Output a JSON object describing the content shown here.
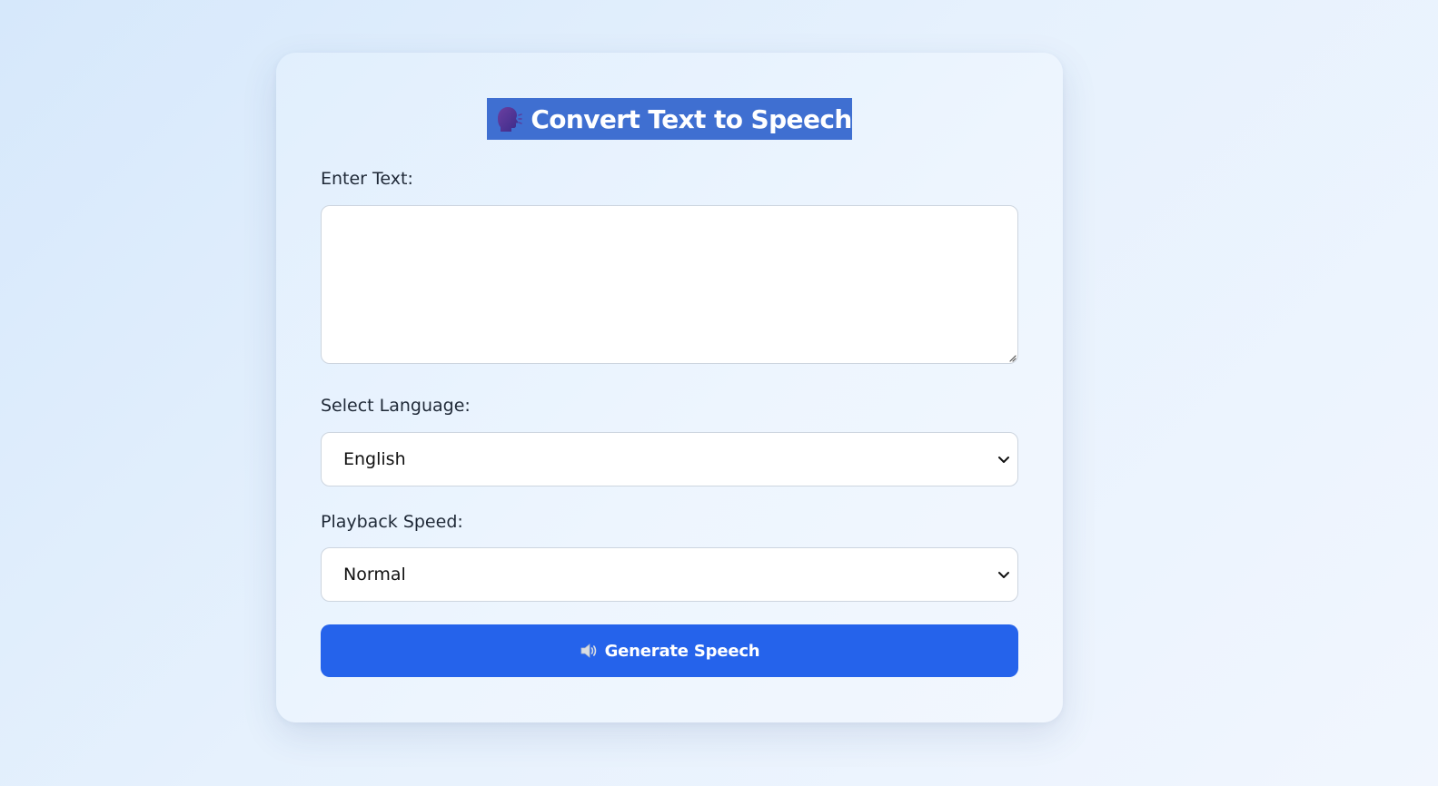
{
  "page": {
    "title_icon": "speaking-head-icon",
    "title": "Convert Text to Speech"
  },
  "form": {
    "text_label": "Enter Text:",
    "text_value": "",
    "language_label": "Select Language:",
    "language_selected": "English",
    "speed_label": "Playback Speed:",
    "speed_selected": "Normal",
    "generate_icon": "speaker-icon",
    "generate_label": "Generate Speech"
  },
  "colors": {
    "accent": "#2563eb",
    "title_highlight": "#3f6fd1",
    "card_background": "#eaf3fe"
  }
}
